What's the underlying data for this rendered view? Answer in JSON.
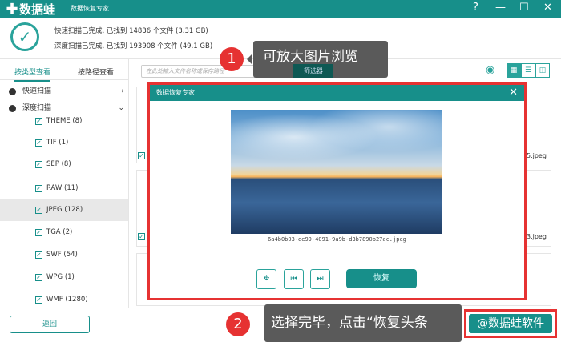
{
  "app": {
    "logo": "数据蛙",
    "subtitle": "数据恢复专家",
    "help": "?",
    "minimize": "—",
    "maximize": "☐",
    "close": "✕"
  },
  "summary": {
    "quick": "快速扫描已完成, 已找到 14836 个文件 (3.31 GB)",
    "deep": "深度扫描已完成, 已找到 193908 个文件 (49.1 GB)"
  },
  "sidebar": {
    "tabs": [
      "按类型查看",
      "按路径查看"
    ],
    "sections": [
      {
        "label": "快速扫描"
      },
      {
        "label": "深度扫描"
      }
    ],
    "items": [
      {
        "label": "THEME (8)"
      },
      {
        "label": "TIF (1)"
      },
      {
        "label": "SEP (8)"
      },
      {
        "label": "RAW (11)"
      },
      {
        "label": "JPEG (128)",
        "selected": true
      },
      {
        "label": "TGA (2)"
      },
      {
        "label": "SWF (54)"
      },
      {
        "label": "WPG (1)"
      },
      {
        "label": "WMF (1280)"
      }
    ]
  },
  "toolbar": {
    "search_placeholder": "在此处输入文件名称或保存路径",
    "filter": "筛选器"
  },
  "files": {
    "right1": "5.jpeg",
    "right2": "3.jpeg"
  },
  "dialog": {
    "title": "数据恢复专家",
    "close": "✕",
    "filename": "6a4b0b03-ee99-4091-9a9b-d3b7890b27ac.jpeg",
    "recover": "恢复"
  },
  "annotations": {
    "step1_num": "1",
    "step1": "可放大图片浏览",
    "step2_num": "2",
    "step2": "选择完毕，点击“恢复头条",
    "watermark": "@数据蛙软件"
  },
  "bottom": {
    "back": "返回"
  }
}
